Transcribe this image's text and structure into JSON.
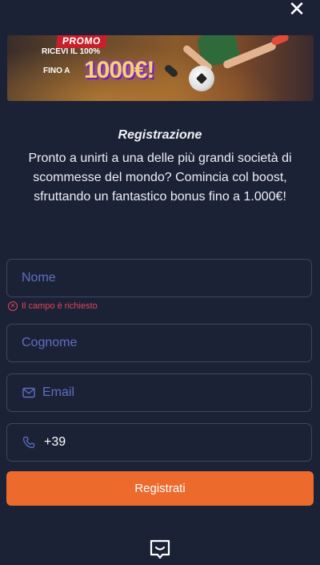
{
  "close_symbol": "✕",
  "banner": {
    "badge": "PROMO",
    "line1": "RICEVI IL 100%",
    "line2": "FINO A",
    "amount": "1000€!"
  },
  "title": "Registrazione",
  "description": "Pronto a unirti a una delle più grandi società di scommesse del mondo? Comincia col boost, sfruttando un fantastico bonus fino a 1.000€!",
  "form": {
    "nome_placeholder": "Nome",
    "nome_error": "Il campo è richiesto",
    "cognome_placeholder": "Cognome",
    "email_placeholder": "Email",
    "phone_prefix": "+39",
    "submit_label": "Registrati"
  },
  "icons": {
    "close": "close-icon",
    "email": "mail-icon",
    "phone": "phone-icon",
    "error": "error-circle-icon",
    "chat": "chat-icon"
  },
  "colors": {
    "background": "#1c2236",
    "accent": "#ed6a2d",
    "placeholder": "#5e6fc1",
    "error": "#e0455a",
    "border": "#3b4566"
  }
}
